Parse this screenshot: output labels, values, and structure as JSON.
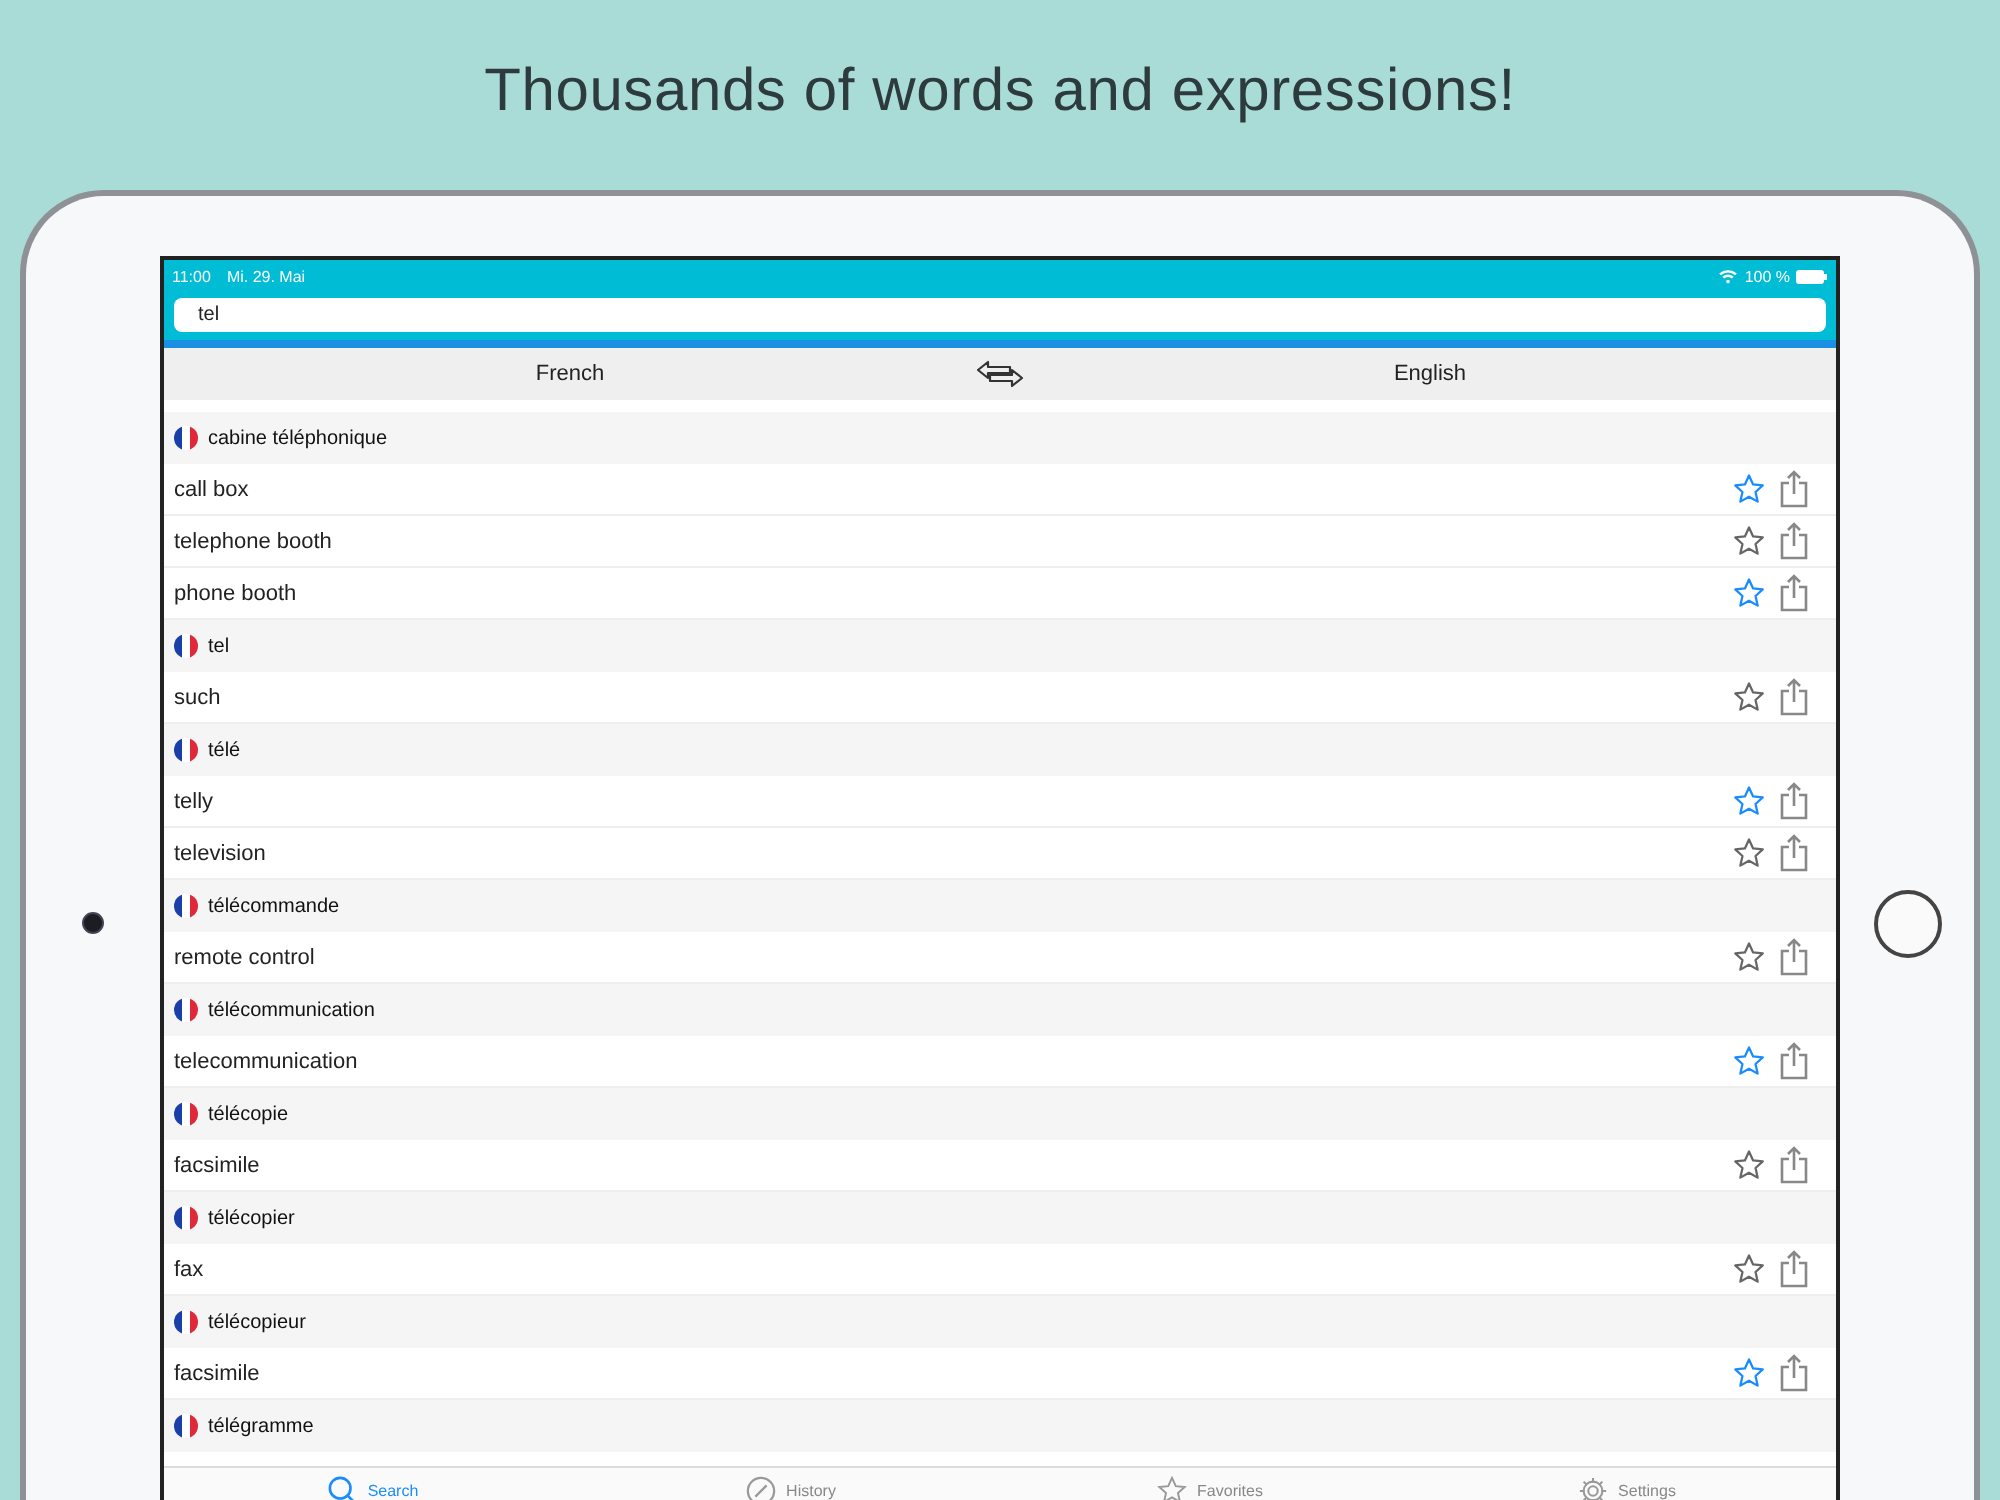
{
  "headline": "Thousands of words and expressions!",
  "status_bar": {
    "time": "11:00",
    "date": "Mi. 29. Mai",
    "battery": "100 %"
  },
  "search": {
    "value": "tel"
  },
  "languages": {
    "from": "French",
    "to": "English"
  },
  "entries": [
    {
      "term": "cabine téléphonique",
      "translations": [
        {
          "text": "call box",
          "favorite": true
        },
        {
          "text": "telephone booth",
          "favorite": false
        },
        {
          "text": "phone booth",
          "favorite": true
        }
      ]
    },
    {
      "term": "tel",
      "translations": [
        {
          "text": "such",
          "favorite": false
        }
      ]
    },
    {
      "term": "télé",
      "translations": [
        {
          "text": "telly",
          "favorite": true
        },
        {
          "text": "television",
          "favorite": false
        }
      ]
    },
    {
      "term": "télécommande",
      "translations": [
        {
          "text": "remote control",
          "favorite": false
        }
      ]
    },
    {
      "term": "télécommunication",
      "translations": [
        {
          "text": "telecommunication",
          "favorite": true
        }
      ]
    },
    {
      "term": "télécopie",
      "translations": [
        {
          "text": "facsimile",
          "favorite": false
        }
      ]
    },
    {
      "term": "télécopier",
      "translations": [
        {
          "text": "fax",
          "favorite": false
        }
      ]
    },
    {
      "term": "télécopieur",
      "translations": [
        {
          "text": "facsimile",
          "favorite": true
        }
      ]
    },
    {
      "term": "télégramme"
    }
  ],
  "tabs": [
    {
      "label": "Search",
      "kind": "search",
      "selected": true
    },
    {
      "label": "History",
      "kind": "history",
      "selected": false
    },
    {
      "label": "Favorites",
      "kind": "favorites",
      "selected": false
    },
    {
      "label": "Settings",
      "kind": "settings",
      "selected": false
    }
  ]
}
